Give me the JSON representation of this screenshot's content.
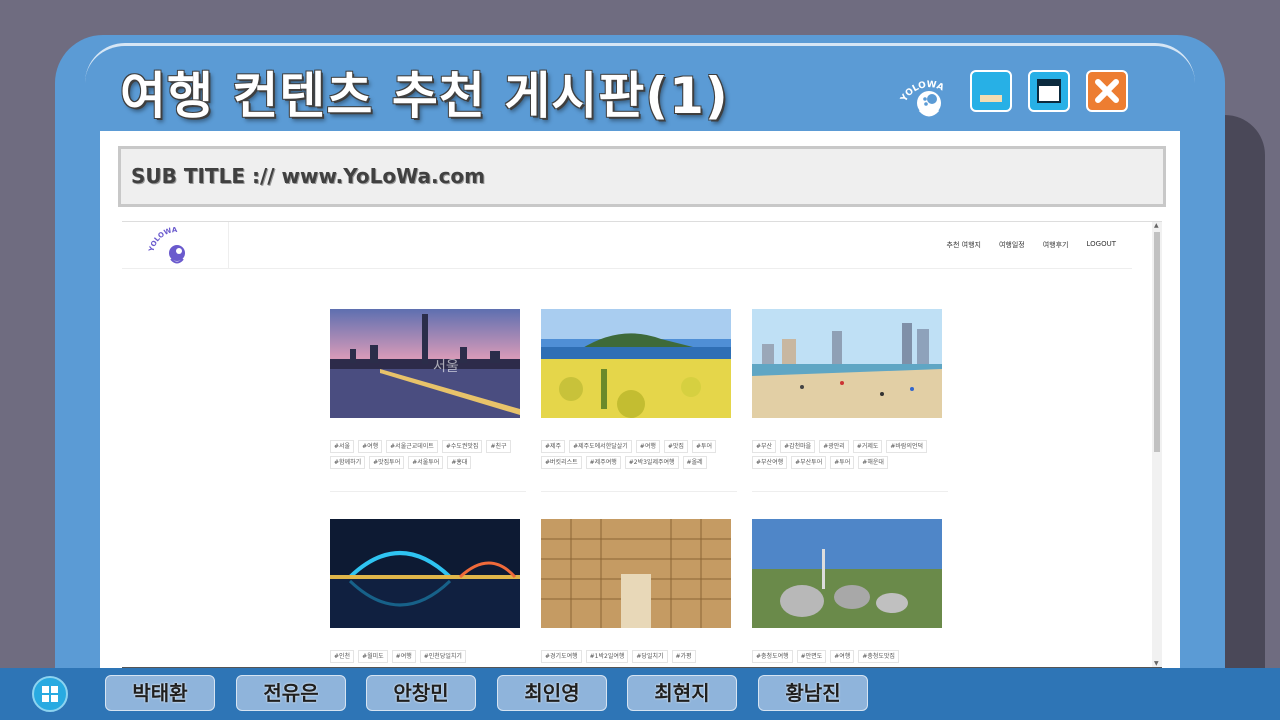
{
  "window": {
    "title": "여행 컨텐츠 추천 게시판(1)",
    "logo_text": "YOLOWA",
    "controls": [
      "minimize",
      "maximize",
      "close"
    ]
  },
  "subtitle": "SUB TITLE :// www.YoLoWa.com",
  "site": {
    "logo_text": "YOLOWA",
    "nav": [
      "추천 여행지",
      "여행일정",
      "여행후기",
      "LOGOUT"
    ]
  },
  "cards": [
    {
      "overlay": "서울",
      "tags": [
        "#서울",
        "#여행",
        "#서울근교데이트",
        "#수도권맛집",
        "#친구",
        "#함께하기",
        "#맛집투어",
        "#서울투어",
        "#홍대"
      ]
    },
    {
      "overlay": "",
      "tags": [
        "#제주",
        "#제주도에서한달살기",
        "#여행",
        "#맛집",
        "#투어",
        "#버킷리스트",
        "#제주여행",
        "#2박3일제주여행",
        "#올레"
      ]
    },
    {
      "overlay": "",
      "tags": [
        "#부산",
        "#감천마을",
        "#광안리",
        "#거제도",
        "#바람의언덕",
        "#부산여행",
        "#부산투어",
        "#투어",
        "#해운대"
      ]
    },
    {
      "overlay": "",
      "tags": [
        "#인천",
        "#월미도",
        "#여행",
        "#인천당일치기"
      ]
    },
    {
      "overlay": "",
      "tags": [
        "#경기도여행",
        "#1박2일여행",
        "#당일치기",
        "#가평"
      ]
    },
    {
      "overlay": "",
      "tags": [
        "#충청도여행",
        "#안면도",
        "#여행",
        "#충청도맛집"
      ]
    }
  ],
  "taskbar": {
    "members": [
      "박태환",
      "전유은",
      "안창민",
      "최인영",
      "최현지",
      "황남진"
    ]
  },
  "colors": {
    "window_blue": "#5b9bd5",
    "taskbar_blue": "#2e75b6",
    "close_orange": "#ed7d31",
    "button_cyan": "#27b0e6"
  }
}
